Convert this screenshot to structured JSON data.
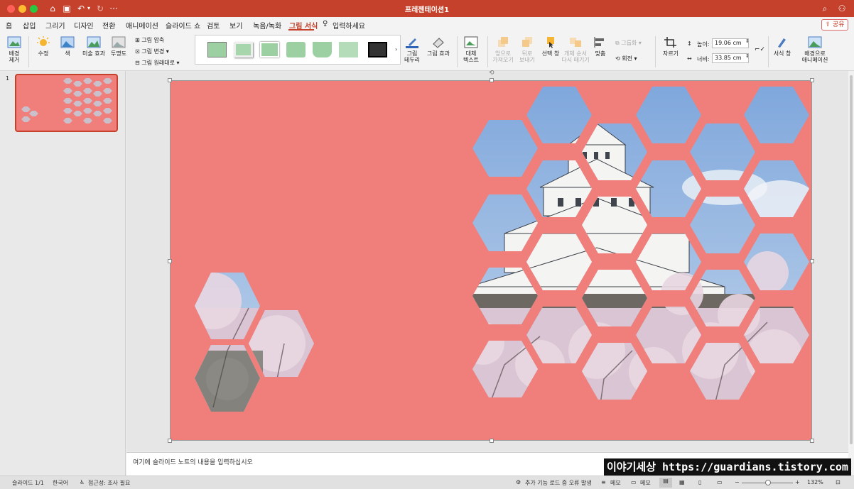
{
  "app": {
    "title": "프레젠테이션1"
  },
  "colors": {
    "accent": "#c5412b",
    "slide_bg": "#f07f7c",
    "sky": "#8fb3e0",
    "blossom": "#d8c2cf"
  },
  "menu": {
    "tabs": [
      "홈",
      "삽입",
      "그리기",
      "디자인",
      "전환",
      "애니메이션",
      "슬라이드 쇼",
      "검토",
      "보기",
      "녹음/녹화",
      "그림 서식"
    ],
    "tell_me": "입력하세요",
    "share": "공유"
  },
  "ribbon": {
    "remove_bg": "배경\n제거",
    "corrections": "수정",
    "color": "색",
    "artistic": "미술 효과",
    "transparency": "투명도",
    "compress": "그림 압축",
    "change": "그림 변경",
    "reset": "그림 원래대로",
    "border": "그림\n테두리",
    "effects": "그림 효과",
    "alt_text": "대체\n텍스트",
    "bring_forward": "앞으로\n가져오기",
    "send_backward": "뒤로\n보내기",
    "selection_pane": "선택 창",
    "reorder": "개체 순서\n다시 매기기",
    "align": "맞춤",
    "group": "그룹화",
    "rotate": "회전",
    "crop": "자르기",
    "height_label": "높이:",
    "height_value": "19.06 cm",
    "width_label": "너비:",
    "width_value": "33.85 cm",
    "format_pane": "서식 창",
    "animate_bg": "배경으로\n애니메이션"
  },
  "slides": {
    "number": "1"
  },
  "notes": {
    "placeholder": "여기에 슬라이드 노트의 내용을 입력하십시오"
  },
  "status": {
    "slide": "슬라이드 1/1",
    "language": "한국어",
    "accessibility": "접근성: 조사 필요",
    "addin": "추가 기능 로드 중 오류 발생",
    "notes": "메모",
    "comments": "메모",
    "zoom": "132%"
  },
  "watermark": "이야기세상 https://guardians.tistory.com"
}
